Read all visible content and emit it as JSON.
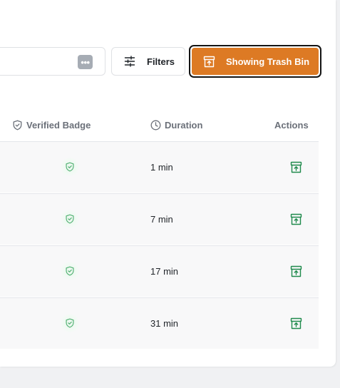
{
  "toolbar": {
    "search_more_label": "•••",
    "filters_label": "Filters",
    "trash_label": "Showing Trash Bin"
  },
  "table": {
    "columns": [
      {
        "label": "Verified Badge",
        "icon": "shield-check-icon"
      },
      {
        "label": "Duration",
        "icon": "clock-icon"
      },
      {
        "label": "Actions"
      }
    ],
    "rows": [
      {
        "verified": true,
        "duration": "1 min",
        "action_icon": "restore-archive-icon"
      },
      {
        "verified": true,
        "duration": "7 min",
        "action_icon": "restore-archive-icon"
      },
      {
        "verified": true,
        "duration": "17 min",
        "action_icon": "restore-archive-icon"
      },
      {
        "verified": true,
        "duration": "31 min",
        "action_icon": "restore-archive-icon"
      }
    ]
  },
  "colors": {
    "accent": "#dd7a24",
    "verified_green": "#4caf6e",
    "action_green": "#1f8a4c",
    "header_text": "#6b7079"
  }
}
